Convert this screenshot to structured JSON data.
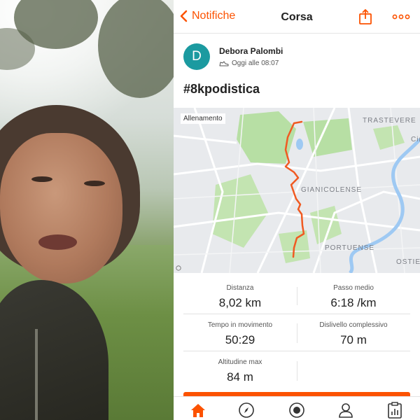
{
  "header": {
    "back_label": "Notifiche",
    "title": "Corsa"
  },
  "athlete": {
    "initial": "D",
    "name": "Debora Palombi",
    "timestamp": "Oggi alle 08:07",
    "avatar_color": "#1b9aa0"
  },
  "activity": {
    "title": "#8kpodistica"
  },
  "map": {
    "tag": "Allenamento",
    "labels": [
      "TRASTEVERE",
      "Cir",
      "GIANICOLENSE",
      "PORTUENSE",
      "OSTIE"
    ]
  },
  "stats": {
    "distance_label": "Distanza",
    "distance_value": "8,02 km",
    "pace_label": "Passo medio",
    "pace_value": "6:18 /km",
    "moving_time_label": "Tempo in movimento",
    "moving_time_value": "50:29",
    "elevation_label": "Dislivello complessivo",
    "elevation_value": "70 m",
    "max_alt_label": "Altitudine max",
    "max_alt_value": "84 m"
  },
  "tabbar": {
    "items": [
      "home-icon",
      "explore-icon",
      "record-icon",
      "profile-icon",
      "training-log-icon"
    ],
    "active": "home-icon"
  },
  "colors": {
    "accent": "#fc5200",
    "route": "#f05a22",
    "park": "#b7dfa4",
    "water": "#9ec9f3"
  }
}
